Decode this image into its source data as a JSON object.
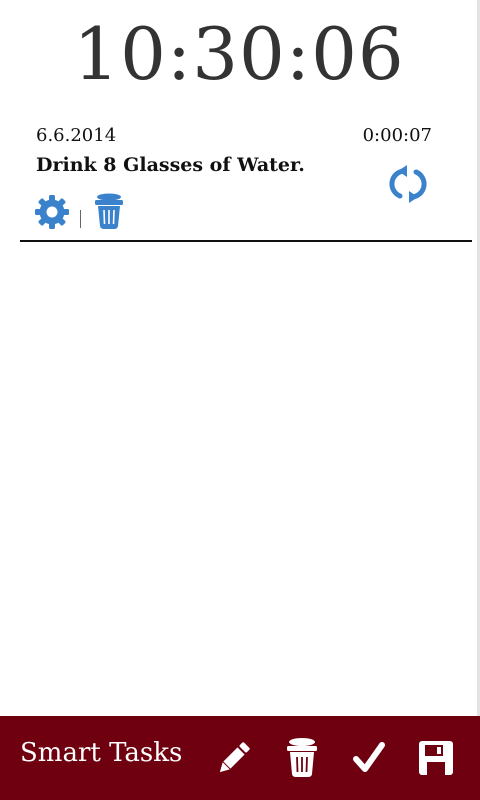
{
  "clock": {
    "time": "10:30:06"
  },
  "task": {
    "date": "6.6.2014",
    "timer": "0:00:07",
    "title": "Drink 8 Glasses of Water.",
    "actions": {
      "settings_icon": "gear-icon",
      "delete_icon": "trash-icon",
      "repeat_icon": "refresh-icon"
    }
  },
  "bottom_bar": {
    "app_name": "Smart Tasks",
    "buttons": [
      "pencil-icon",
      "trash-icon",
      "checkmark-icon",
      "save-icon"
    ]
  },
  "colors": {
    "accent_blue": "#3a82cc",
    "bar_background": "#6e0010",
    "bar_icon": "#ffffff",
    "clock_text": "#333333"
  }
}
